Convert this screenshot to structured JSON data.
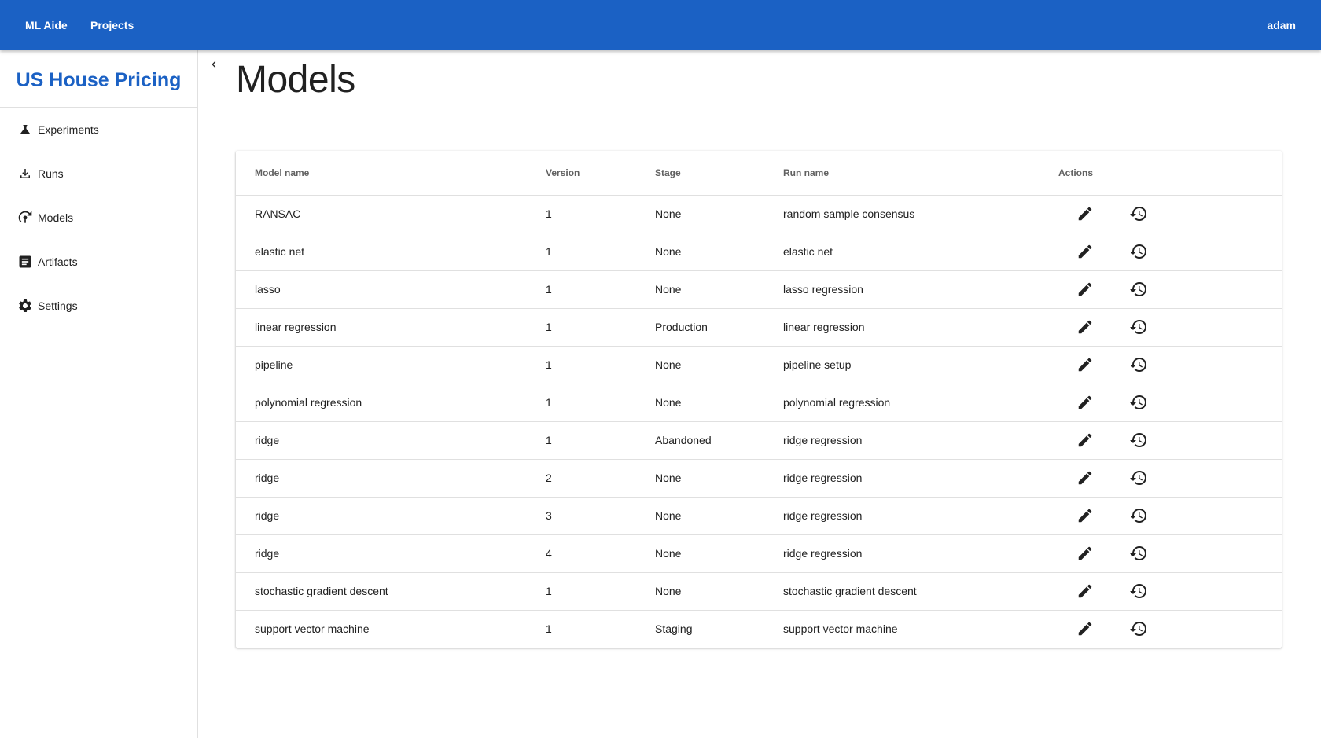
{
  "appbar": {
    "brand": "ML Aide",
    "projects": "Projects",
    "user": "adam"
  },
  "sidebar": {
    "project_title": "US House Pricing",
    "items": [
      {
        "label": "Experiments",
        "icon": "flask-icon"
      },
      {
        "label": "Runs",
        "icon": "run-icon"
      },
      {
        "label": "Models",
        "icon": "model-icon"
      },
      {
        "label": "Artifacts",
        "icon": "document-icon"
      },
      {
        "label": "Settings",
        "icon": "gear-icon"
      }
    ]
  },
  "page": {
    "title": "Models"
  },
  "table": {
    "headers": {
      "model_name": "Model name",
      "version": "Version",
      "stage": "Stage",
      "run_name": "Run name",
      "actions": "Actions"
    },
    "rows": [
      {
        "model_name": "RANSAC",
        "version": "1",
        "stage": "None",
        "run_name": "random sample consensus"
      },
      {
        "model_name": "elastic net",
        "version": "1",
        "stage": "None",
        "run_name": "elastic net"
      },
      {
        "model_name": "lasso",
        "version": "1",
        "stage": "None",
        "run_name": "lasso regression"
      },
      {
        "model_name": "linear regression",
        "version": "1",
        "stage": "Production",
        "run_name": "linear regression"
      },
      {
        "model_name": "pipeline",
        "version": "1",
        "stage": "None",
        "run_name": "pipeline setup"
      },
      {
        "model_name": "polynomial regression",
        "version": "1",
        "stage": "None",
        "run_name": "polynomial regression"
      },
      {
        "model_name": "ridge",
        "version": "1",
        "stage": "Abandoned",
        "run_name": "ridge regression"
      },
      {
        "model_name": "ridge",
        "version": "2",
        "stage": "None",
        "run_name": "ridge regression"
      },
      {
        "model_name": "ridge",
        "version": "3",
        "stage": "None",
        "run_name": "ridge regression"
      },
      {
        "model_name": "ridge",
        "version": "4",
        "stage": "None",
        "run_name": "ridge regression"
      },
      {
        "model_name": "stochastic gradient descent",
        "version": "1",
        "stage": "None",
        "run_name": "stochastic gradient descent"
      },
      {
        "model_name": "support vector machine",
        "version": "1",
        "stage": "Staging",
        "run_name": "support vector machine"
      }
    ],
    "action_icons": [
      "edit-icon",
      "history-icon"
    ]
  },
  "colors": {
    "appbar": "#1b61c4",
    "project_title": "#1b61c4"
  }
}
